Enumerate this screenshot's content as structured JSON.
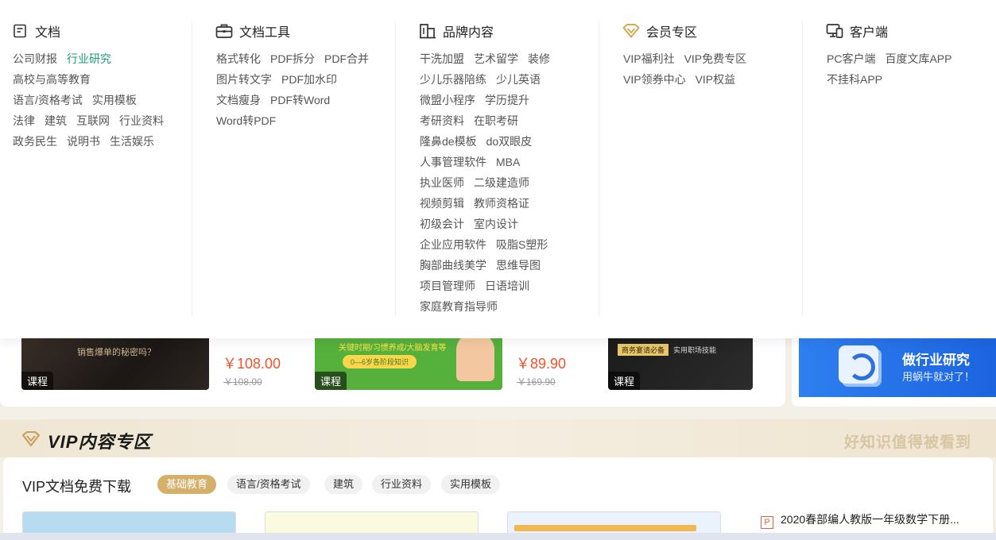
{
  "menu": {
    "columns": [
      {
        "title": "文档",
        "icon": "document-icon",
        "rows": [
          [
            "公司财报",
            "行业研究"
          ],
          [
            "高校与高等教育"
          ],
          [
            "语言/资格考试",
            "实用模板"
          ],
          [
            "法律",
            "建筑",
            "互联网",
            "行业资料"
          ],
          [
            "政务民生",
            "说明书",
            "生活娱乐"
          ]
        ]
      },
      {
        "title": "文档工具",
        "icon": "toolbox-icon",
        "rows": [
          [
            "格式转化",
            "PDF拆分",
            "PDF合并"
          ],
          [
            "图片转文字",
            "PDF加水印"
          ],
          [
            "文档瘦身",
            "PDF转Word"
          ],
          [
            "Word转PDF"
          ]
        ]
      },
      {
        "title": "品牌内容",
        "icon": "brand-icon",
        "rows": [
          [
            "干洗加盟",
            "艺术留学",
            "装修"
          ],
          [
            "少儿乐器陪练",
            "少儿英语"
          ],
          [
            "微盟小程序",
            "学历提升"
          ],
          [
            "考研资料",
            "在职考研"
          ],
          [
            "隆鼻de模板",
            "do双眼皮"
          ],
          [
            "人事管理软件",
            "MBA"
          ],
          [
            "执业医师",
            "二级建造师"
          ],
          [
            "视频剪辑",
            "教师资格证"
          ],
          [
            "初级会计",
            "室内设计"
          ],
          [
            "企业应用软件",
            "吸脂S塑形"
          ],
          [
            "胸部曲线美学",
            "思维导图"
          ],
          [
            "项目管理师",
            "日语培训"
          ],
          [
            "家庭教育指导师"
          ]
        ]
      },
      {
        "title": "会员专区",
        "icon": "vip-diamond-icon",
        "rows": [
          [
            "VIP福利社",
            "VIP免费专区"
          ],
          [
            "VIP领券中心",
            "VIP权益"
          ]
        ]
      },
      {
        "title": "客户端",
        "icon": "devices-icon",
        "rows": [
          [
            "PC客户端",
            "百度文库APP"
          ],
          [
            "不挂科APP"
          ]
        ]
      }
    ],
    "highlight_item": "行业研究",
    "highlight_color": "#1ba176"
  },
  "courses": [
    {
      "tag": "课程",
      "subtitle": "销售爆单的秘密吗？",
      "price": "￥108.00",
      "original_price": "￥108.00"
    },
    {
      "tag": "课程",
      "line1": "关键时期/习惯养成/大脑发育等",
      "pill": "0—6岁各阶段知识",
      "price": "￥89.90",
      "original_price": "￥169.90"
    },
    {
      "tag": "课程",
      "badge": "商务宴请必备",
      "subtitle": "实用职场技能"
    }
  ],
  "banner": {
    "title": "做行业研究",
    "subtitle": "用蜗牛就对了！"
  },
  "vip_section": {
    "logo_text": "VIP内容专区",
    "slogan": "好知识值得被看到",
    "panel_title": "VIP文档免费下载",
    "tabs": [
      "基础教育",
      "语言/资格考试",
      "建筑",
      "行业资料",
      "实用模板"
    ],
    "active_tab": "基础教育",
    "side_doc": {
      "icon": "ppt-file-icon",
      "label": "P",
      "title": "2020春部编人教版一年级数学下册..."
    }
  },
  "colors": {
    "accent_gold": "#d4b06b",
    "price_red": "#f0542d",
    "link_green": "#1ba176"
  }
}
